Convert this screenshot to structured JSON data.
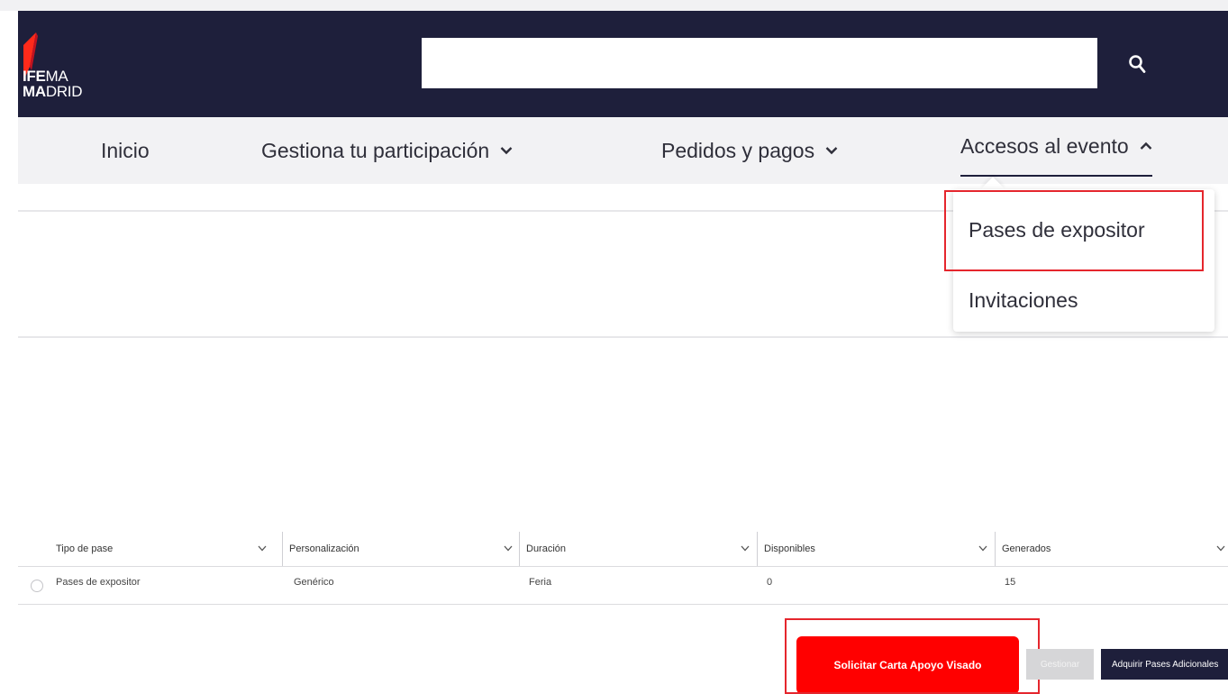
{
  "header": {
    "logo_line1": {
      "bold": "IFE",
      "regular": "MA"
    },
    "logo_line2": {
      "bold": "MA",
      "regular": "DRID"
    },
    "search_value": "",
    "search_icon": "search-icon"
  },
  "nav": {
    "items": [
      {
        "label": "Inicio",
        "has_chevron": false
      },
      {
        "label": "Gestiona tu participación",
        "has_chevron": true,
        "chevron": "chevron-down-icon"
      },
      {
        "label": "Pedidos y pagos",
        "has_chevron": true,
        "chevron": "chevron-down-icon"
      },
      {
        "label": "Accesos al evento",
        "has_chevron": true,
        "chevron": "chevron-up-icon",
        "active": true
      }
    ]
  },
  "dropdown": {
    "items": [
      {
        "label": "Pases de expositor",
        "highlighted": true
      },
      {
        "label": "Invitaciones"
      }
    ]
  },
  "table": {
    "columns": [
      "Tipo de pase",
      "Personalización",
      "Duración",
      "Disponibles",
      "Generados"
    ],
    "rows": [
      [
        "Pases de expositor",
        "Genérico",
        "Feria",
        "0",
        "15"
      ]
    ]
  },
  "actions": {
    "primary_label": "Solicitar Carta Apoyo Visado",
    "disabled_label": "Gestionar",
    "dark_label": "Adquirir Pases Adicionales"
  },
  "colors": {
    "header_bg": "#1e1f3b",
    "nav_bg": "#f2f2f4",
    "brand_red": "#ff0000",
    "highlight_red": "#e5262d"
  }
}
